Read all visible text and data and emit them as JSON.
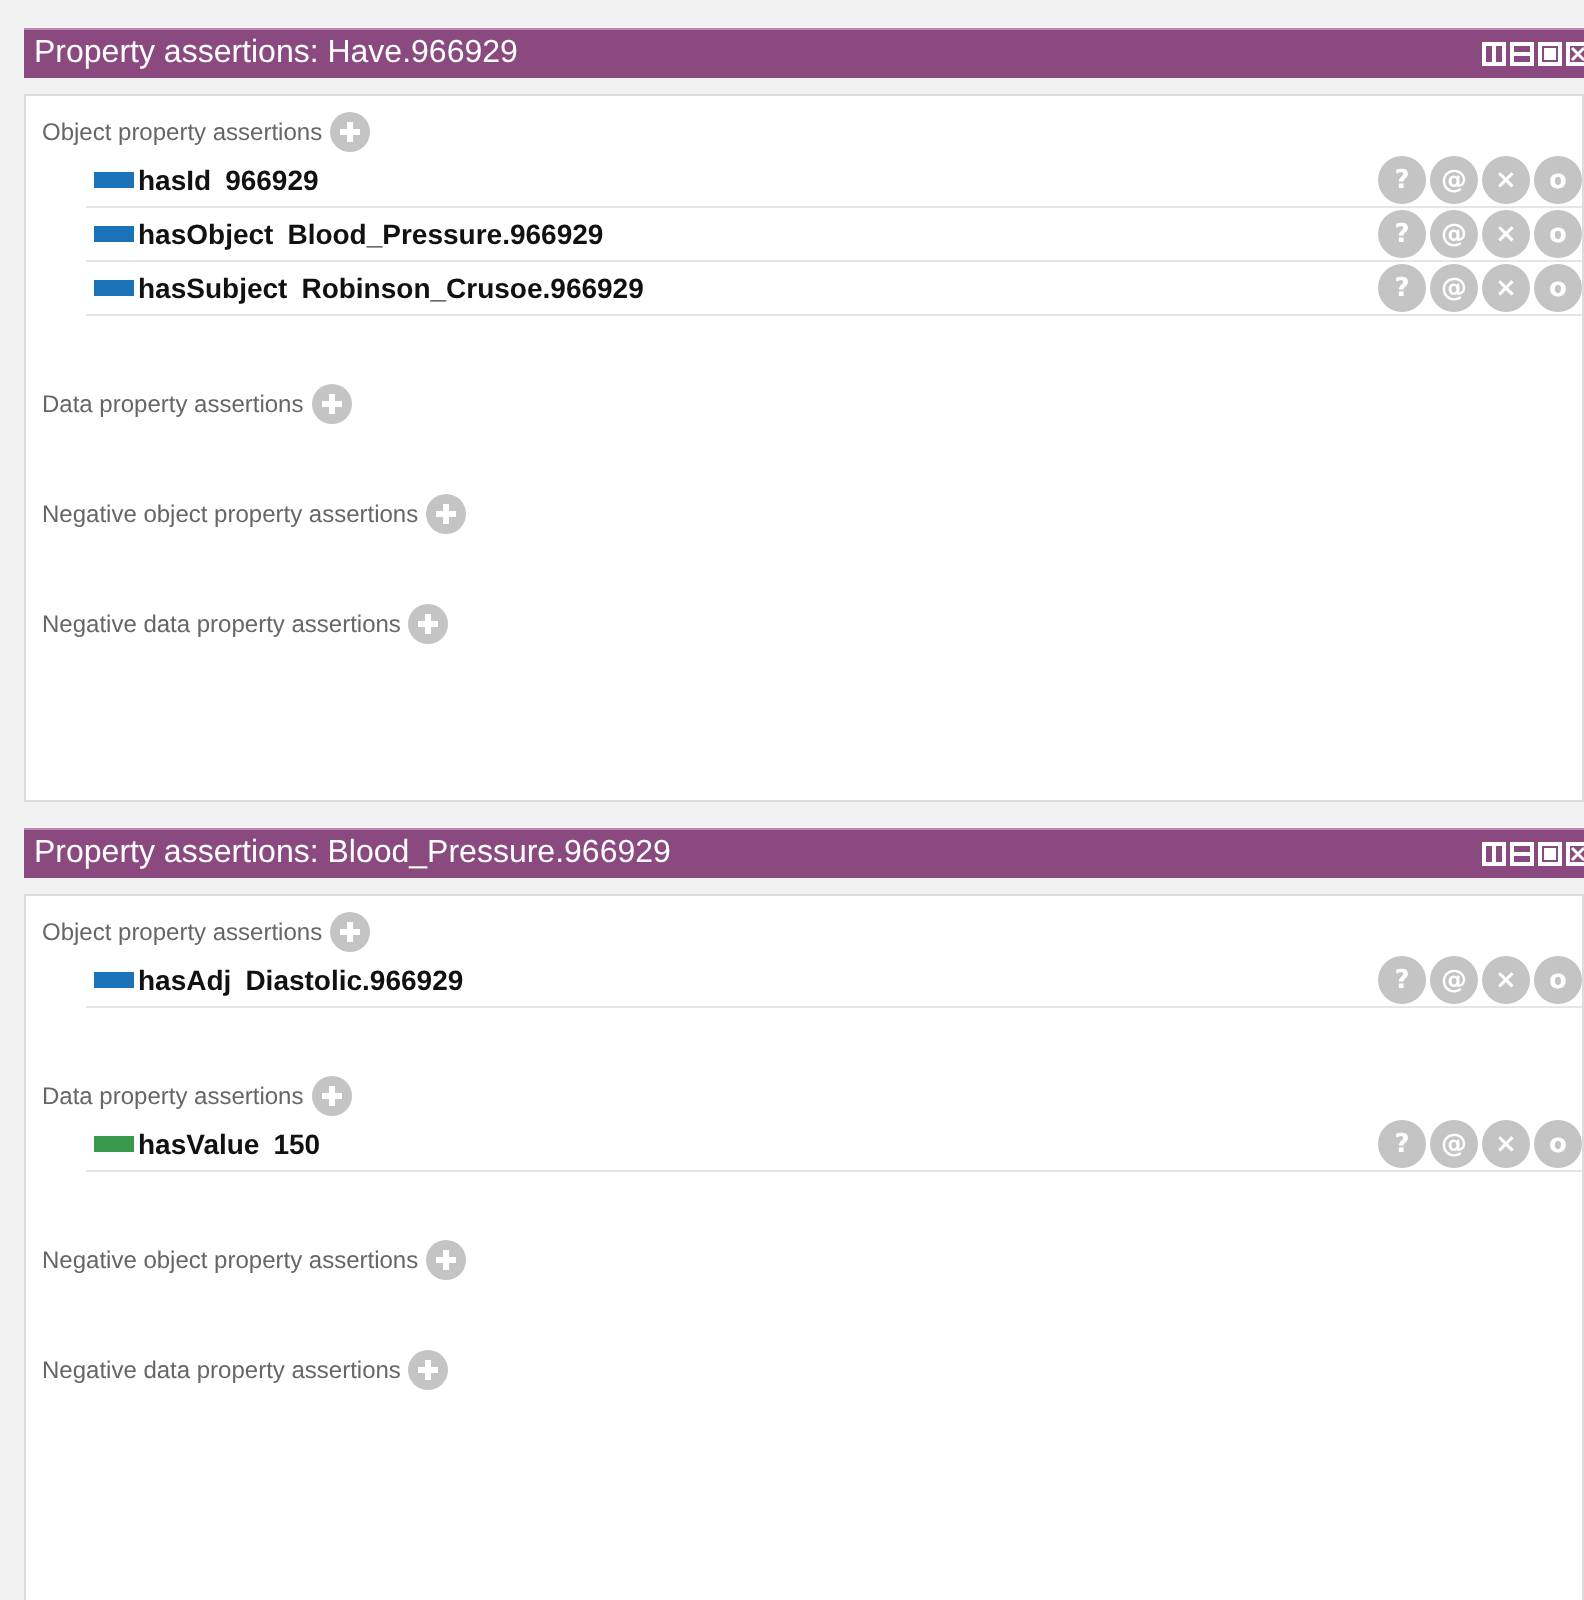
{
  "panels": [
    {
      "title": "Property assertions: Have.966929",
      "sections": [
        {
          "label": "Object property assertions",
          "rows": [
            {
              "property": "hasId",
              "value": "966929",
              "color": "#1a72b8",
              "actions": [
                "?",
                "@",
                "×",
                "o"
              ]
            },
            {
              "property": "hasObject",
              "value": "Blood_Pressure.966929",
              "color": "#1a72b8",
              "actions": [
                "?",
                "@",
                "×",
                "o"
              ]
            },
            {
              "property": "hasSubject",
              "value": "Robinson_Crusoe.966929",
              "color": "#1a72b8",
              "actions": [
                "?",
                "@",
                "×",
                "o"
              ]
            }
          ]
        },
        {
          "label": "Data property assertions"
        },
        {
          "label": "Negative object property assertions"
        },
        {
          "label": "Negative data property assertions"
        }
      ]
    },
    {
      "title": "Property assertions: Blood_Pressure.966929",
      "sections": [
        {
          "label": "Object property assertions",
          "rows": [
            {
              "property": "hasAdj",
              "value": "Diastolic.966929",
              "color": "#1a72b8",
              "actions": [
                "?",
                "@",
                "×",
                "o"
              ]
            }
          ]
        },
        {
          "label": "Data property assertions",
          "rows": [
            {
              "property": "hasValue",
              "value": "150",
              "color": "#3a9a4c",
              "actions": [
                "?",
                "@",
                "×",
                "o"
              ]
            }
          ]
        },
        {
          "label": "Negative object property assertions"
        },
        {
          "label": "Negative data property assertions"
        }
      ]
    }
  ]
}
